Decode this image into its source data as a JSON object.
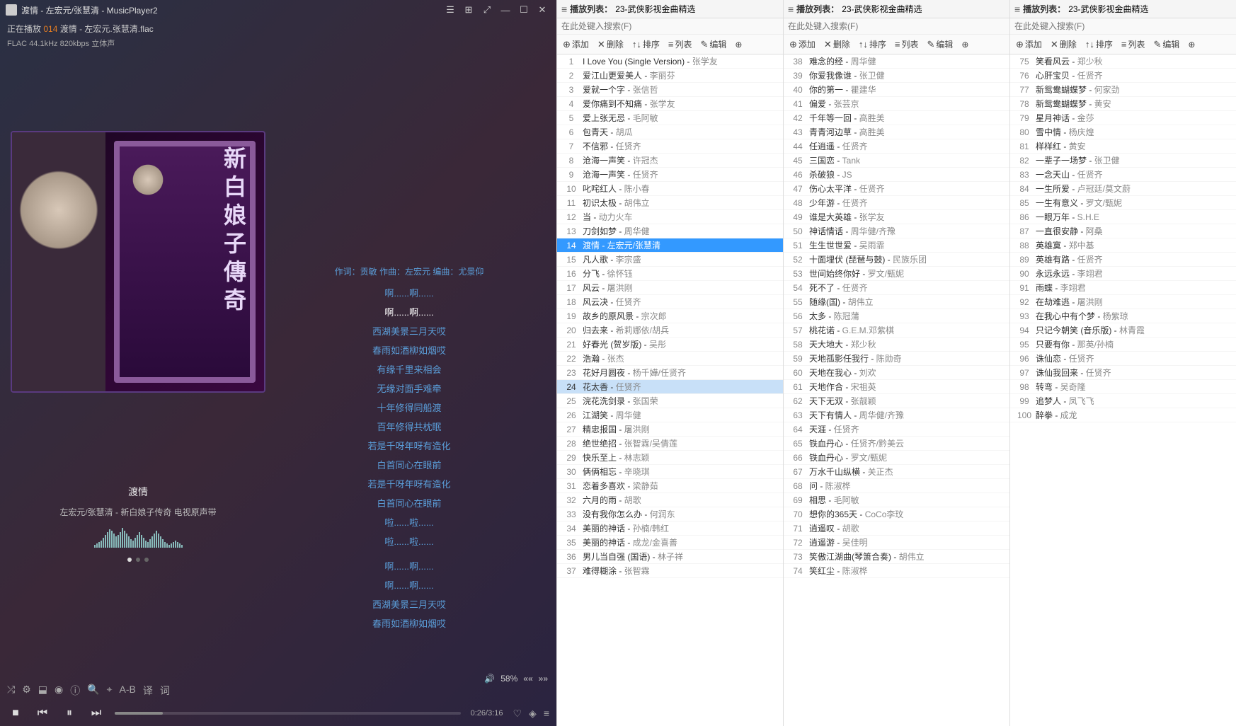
{
  "app": {
    "title": "渡情 - 左宏元/张慧清 - MusicPlayer2"
  },
  "nowplaying": {
    "prefix": "正在播放",
    "index": "014",
    "filename": "渡情 - 左宏元.张慧清.flac",
    "audioinfo": "FLAC 44.1kHz 820kbps 立体声"
  },
  "album": {
    "vertical_text": "新白娘子傳奇",
    "title": "渡情",
    "subtitle": "左宏元/张慧清 - 新白娘子传奇 电视原声带"
  },
  "lyrics": {
    "credits": "作词：贡敏 作曲：左宏元 编曲：尤景仰",
    "lines_above": [
      "啊......啊......"
    ],
    "current": "啊......啊......",
    "lines_below": [
      "西湖美景三月天哎",
      "春雨如酒柳如烟哎",
      "有缘千里来相会",
      "无缘对面手难牵",
      "十年修得同船渡",
      "百年修得共枕眠",
      "若是千呀年呀有造化",
      "白首同心在眼前",
      "若是千呀年呀有造化",
      "白首同心在眼前",
      "啦......啦......",
      "啦......啦......",
      "",
      "啊......啊......",
      "啊......啊......",
      "西湖美景三月天哎",
      "春雨如酒柳如烟哎"
    ]
  },
  "volume": {
    "label": "58%"
  },
  "transport": {
    "time": "0:26/3:16"
  },
  "toolbar_labels": {
    "ab": "A-B",
    "trans": "译",
    "lyr": "词"
  },
  "playlist_header": {
    "prefix": "播放列表：",
    "name": "23-武侠影视金曲精选"
  },
  "search_placeholder": "在此处键入搜索(F)",
  "panel_buttons": {
    "add": "添加",
    "del": "删除",
    "sort": "排序",
    "list": "列表",
    "edit": "编辑"
  },
  "tracks1": [
    {
      "n": 1,
      "t": "I Love You (Single Version)",
      "a": "张学友"
    },
    {
      "n": 2,
      "t": "爱江山更爱美人",
      "a": "李丽芬"
    },
    {
      "n": 3,
      "t": "爱就一个字",
      "a": "张信哲"
    },
    {
      "n": 4,
      "t": "爱你痛到不知痛",
      "a": "张学友"
    },
    {
      "n": 5,
      "t": "爱上张无忌",
      "a": "毛阿敏"
    },
    {
      "n": 6,
      "t": "包青天",
      "a": "胡瓜"
    },
    {
      "n": 7,
      "t": "不信邪",
      "a": "任贤齐"
    },
    {
      "n": 8,
      "t": "沧海一声笑",
      "a": "许冠杰"
    },
    {
      "n": 9,
      "t": "沧海一声笑",
      "a": "任贤齐"
    },
    {
      "n": 10,
      "t": "叱咤红人",
      "a": "陈小春"
    },
    {
      "n": 11,
      "t": "初识太极",
      "a": "胡伟立"
    },
    {
      "n": 12,
      "t": "当",
      "a": "动力火车"
    },
    {
      "n": 13,
      "t": "刀剑如梦",
      "a": "周华健"
    },
    {
      "n": 14,
      "t": "渡情",
      "a": "左宏元/张慧清",
      "playing": true
    },
    {
      "n": 15,
      "t": "凡人歌",
      "a": "李宗盛"
    },
    {
      "n": 16,
      "t": "分飞",
      "a": "徐怀钰"
    },
    {
      "n": 17,
      "t": "风云",
      "a": "屠洪刚"
    },
    {
      "n": 18,
      "t": "风云决",
      "a": "任贤齐"
    },
    {
      "n": 19,
      "t": "故乡的原风景",
      "a": "宗次郎"
    },
    {
      "n": 20,
      "t": "归去来",
      "a": "希莉娜依/胡兵"
    },
    {
      "n": 21,
      "t": "好春光 (贺岁版)",
      "a": "吴彤"
    },
    {
      "n": 22,
      "t": "浩瀚",
      "a": "张杰"
    },
    {
      "n": 23,
      "t": "花好月圆夜",
      "a": "杨千嬅/任贤齐"
    },
    {
      "n": 24,
      "t": "花太香",
      "a": "任贤齐",
      "selected": true
    },
    {
      "n": 25,
      "t": "浣花洗剑录",
      "a": "张国荣"
    },
    {
      "n": 26,
      "t": "江湖笑",
      "a": "周华健"
    },
    {
      "n": 27,
      "t": "精忠报国",
      "a": "屠洪刚"
    },
    {
      "n": 28,
      "t": "绝世绝招",
      "a": "张智霖/吴倩莲"
    },
    {
      "n": 29,
      "t": "快乐至上",
      "a": "林志颖"
    },
    {
      "n": 30,
      "t": "俩俩相忘",
      "a": "辛晓琪"
    },
    {
      "n": 31,
      "t": "恋着多喜欢",
      "a": "梁静茹"
    },
    {
      "n": 32,
      "t": "六月的雨",
      "a": "胡歌"
    },
    {
      "n": 33,
      "t": "没有我你怎么办",
      "a": "何润东"
    },
    {
      "n": 34,
      "t": "美丽的神话",
      "a": "孙楠/韩红"
    },
    {
      "n": 35,
      "t": "美丽的神话",
      "a": "成龙/金喜善"
    },
    {
      "n": 36,
      "t": "男儿当自强 (国语)",
      "a": "林子祥"
    },
    {
      "n": 37,
      "t": "难得糊涂",
      "a": "张智霖"
    }
  ],
  "tracks2": [
    {
      "n": 38,
      "t": "难念的经",
      "a": "周华健"
    },
    {
      "n": 39,
      "t": "你爱我像谁",
      "a": "张卫健"
    },
    {
      "n": 40,
      "t": "你的第一",
      "a": "瞿建华"
    },
    {
      "n": 41,
      "t": "偏爱",
      "a": "张芸京"
    },
    {
      "n": 42,
      "t": "千年等一回",
      "a": "高胜美"
    },
    {
      "n": 43,
      "t": "青青河边草",
      "a": "高胜美"
    },
    {
      "n": 44,
      "t": "任逍遥",
      "a": "任贤齐"
    },
    {
      "n": 45,
      "t": "三国恋",
      "a": "Tank"
    },
    {
      "n": 46,
      "t": "杀破狼",
      "a": "JS"
    },
    {
      "n": 47,
      "t": "伤心太平洋",
      "a": "任贤齐"
    },
    {
      "n": 48,
      "t": "少年游",
      "a": "任贤齐"
    },
    {
      "n": 49,
      "t": "谁是大英雄",
      "a": "张学友"
    },
    {
      "n": 50,
      "t": "神话情话",
      "a": "周华健/齐豫"
    },
    {
      "n": 51,
      "t": "生生世世爱",
      "a": "吴雨霏"
    },
    {
      "n": 52,
      "t": "十面埋伏 (琵琶与鼓)",
      "a": "民族乐团"
    },
    {
      "n": 53,
      "t": "世间始终你好",
      "a": "罗文/甄妮"
    },
    {
      "n": 54,
      "t": "死不了",
      "a": "任贤齐"
    },
    {
      "n": 55,
      "t": "随缘(国)",
      "a": "胡伟立"
    },
    {
      "n": 56,
      "t": "太多",
      "a": "陈冠蒲"
    },
    {
      "n": 57,
      "t": "桃花诺",
      "a": "G.E.M.邓紫棋"
    },
    {
      "n": 58,
      "t": "天大地大",
      "a": "郑少秋"
    },
    {
      "n": 59,
      "t": "天地孤影任我行",
      "a": "陈勋奇"
    },
    {
      "n": 60,
      "t": "天地在我心",
      "a": "刘欢"
    },
    {
      "n": 61,
      "t": "天地作合",
      "a": "宋祖英"
    },
    {
      "n": 62,
      "t": "天下无双",
      "a": "张靓颖"
    },
    {
      "n": 63,
      "t": "天下有情人",
      "a": "周华健/齐豫"
    },
    {
      "n": 64,
      "t": "天涯",
      "a": "任贤齐"
    },
    {
      "n": 65,
      "t": "铁血丹心",
      "a": "任贤齐/黔美云"
    },
    {
      "n": 66,
      "t": "铁血丹心",
      "a": "罗文/甄妮"
    },
    {
      "n": 67,
      "t": "万水千山纵横",
      "a": "关正杰"
    },
    {
      "n": 68,
      "t": "问",
      "a": "陈淑桦"
    },
    {
      "n": 69,
      "t": "相思",
      "a": "毛阿敏"
    },
    {
      "n": 70,
      "t": "想你的365天",
      "a": "CoCo李玟"
    },
    {
      "n": 71,
      "t": "逍遥叹",
      "a": "胡歌"
    },
    {
      "n": 72,
      "t": "逍遥游",
      "a": "吴佳明"
    },
    {
      "n": 73,
      "t": "笑傲江湖曲(琴箫合奏)",
      "a": "胡伟立"
    },
    {
      "n": 74,
      "t": "笑红尘",
      "a": "陈淑桦"
    }
  ],
  "tracks3": [
    {
      "n": 75,
      "t": "笑看风云",
      "a": "郑少秋"
    },
    {
      "n": 76,
      "t": "心肝宝贝",
      "a": "任贤齐"
    },
    {
      "n": 77,
      "t": "新鸳鸯蝴蝶梦",
      "a": "何家劲"
    },
    {
      "n": 78,
      "t": "新鸳鸯蝴蝶梦",
      "a": "黄安"
    },
    {
      "n": 79,
      "t": "星月神话",
      "a": "金莎"
    },
    {
      "n": 80,
      "t": "雪中情",
      "a": "杨庆煌"
    },
    {
      "n": 81,
      "t": "样样红",
      "a": "黄安"
    },
    {
      "n": 82,
      "t": "一辈子一场梦",
      "a": "张卫健"
    },
    {
      "n": 83,
      "t": "一念天山",
      "a": "任贤齐"
    },
    {
      "n": 84,
      "t": "一生所爱",
      "a": "卢冠廷/莫文蔚"
    },
    {
      "n": 85,
      "t": "一生有意义",
      "a": "罗文/甄妮"
    },
    {
      "n": 86,
      "t": "一眼万年",
      "a": "S.H.E"
    },
    {
      "n": 87,
      "t": "一直很安静",
      "a": "阿桑"
    },
    {
      "n": 88,
      "t": "英雄寞",
      "a": "郑中基"
    },
    {
      "n": 89,
      "t": "英雄有路",
      "a": "任贤齐"
    },
    {
      "n": 90,
      "t": "永远永远",
      "a": "李翊君"
    },
    {
      "n": 91,
      "t": "雨蝶",
      "a": "李翊君"
    },
    {
      "n": 92,
      "t": "在劫难逃",
      "a": "屠洪刚"
    },
    {
      "n": 93,
      "t": "在我心中有个梦",
      "a": "杨紫琼"
    },
    {
      "n": 94,
      "t": "只记今朝笑 (音乐版)",
      "a": "林青霞"
    },
    {
      "n": 95,
      "t": "只要有你",
      "a": "那英/孙楠"
    },
    {
      "n": 96,
      "t": "诛仙恋",
      "a": "任贤齐"
    },
    {
      "n": 97,
      "t": "诛仙我回来",
      "a": "任贤齐"
    },
    {
      "n": 98,
      "t": "转弯",
      "a": "吴奇隆"
    },
    {
      "n": 99,
      "t": "追梦人",
      "a": "凤飞飞"
    },
    {
      "n": 100,
      "t": "醉拳",
      "a": "成龙"
    }
  ]
}
